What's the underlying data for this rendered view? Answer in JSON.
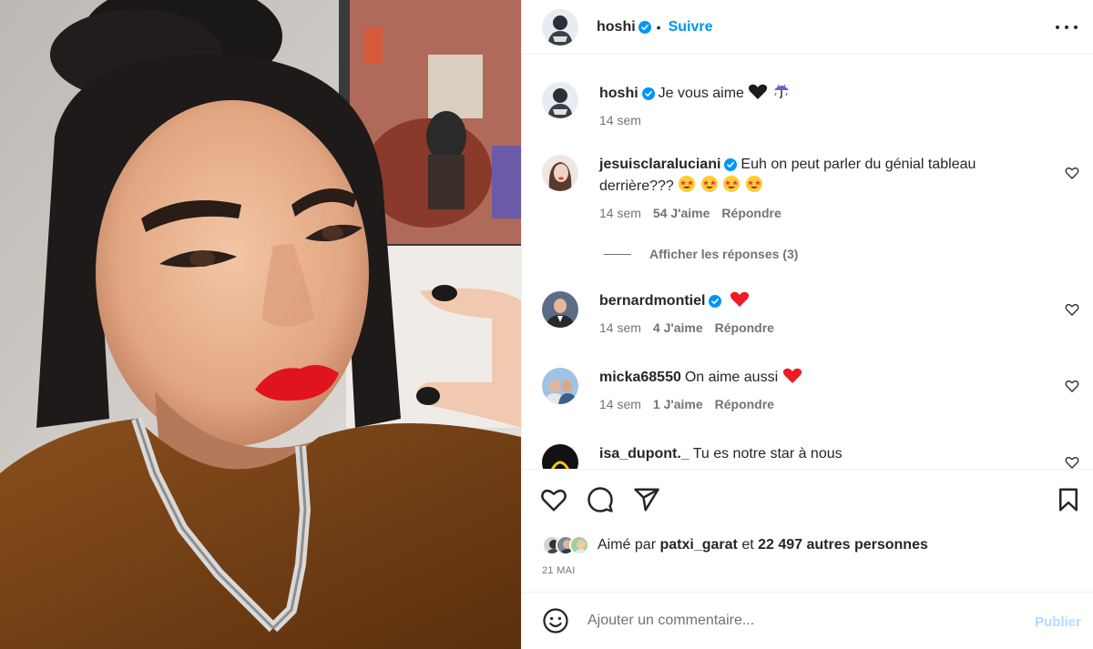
{
  "post": {
    "username": "hoshi",
    "follow_label": "Suivre",
    "dot": "•",
    "more_icon": "more-horizontal-icon"
  },
  "caption": {
    "username": "hoshi",
    "text": "Je vous aime",
    "emojis": [
      "black-heart",
      "umbrella-with-rain"
    ],
    "time": "14 sem"
  },
  "comments": [
    {
      "username": "jesuisclaraluciani",
      "verified": true,
      "text": "Euh on peut parler du génial tableau derrière???",
      "emojis": [
        "star-struck",
        "star-struck",
        "star-struck",
        "star-struck"
      ],
      "time": "14 sem",
      "likes": "54 J'aime",
      "reply_label": "Répondre",
      "view_replies": "Afficher les réponses (3)"
    },
    {
      "username": "bernardmontiel",
      "verified": true,
      "text": "",
      "emojis": [
        "red-heart"
      ],
      "time": "14 sem",
      "likes": "4 J'aime",
      "reply_label": "Répondre"
    },
    {
      "username": "micka68550",
      "verified": false,
      "text": "On aime aussi",
      "emojis": [
        "red-heart"
      ],
      "time": "14 sem",
      "likes": "1 J'aime",
      "reply_label": "Répondre"
    },
    {
      "username": "isa_dupont._",
      "verified": false,
      "text": "Tu es notre star à nous",
      "emojis": []
    }
  ],
  "actions": {
    "icons": [
      "heart-icon",
      "comment-icon",
      "share-icon",
      "bookmark-icon"
    ],
    "liked_by_prefix": "Aimé par",
    "liked_by_user": "patxi_garat",
    "liked_by_and": "et",
    "liked_by_count": "22 497 autres personnes",
    "date": "21 MAI"
  },
  "add_comment": {
    "placeholder": "Ajouter un commentaire...",
    "publish_label": "Publier"
  },
  "colors": {
    "accent": "#0095f6",
    "verified": "#0095f6",
    "publish_disabled": "#b3dbff",
    "secondary_text": "#737373",
    "red_heart": "#ed4956"
  }
}
